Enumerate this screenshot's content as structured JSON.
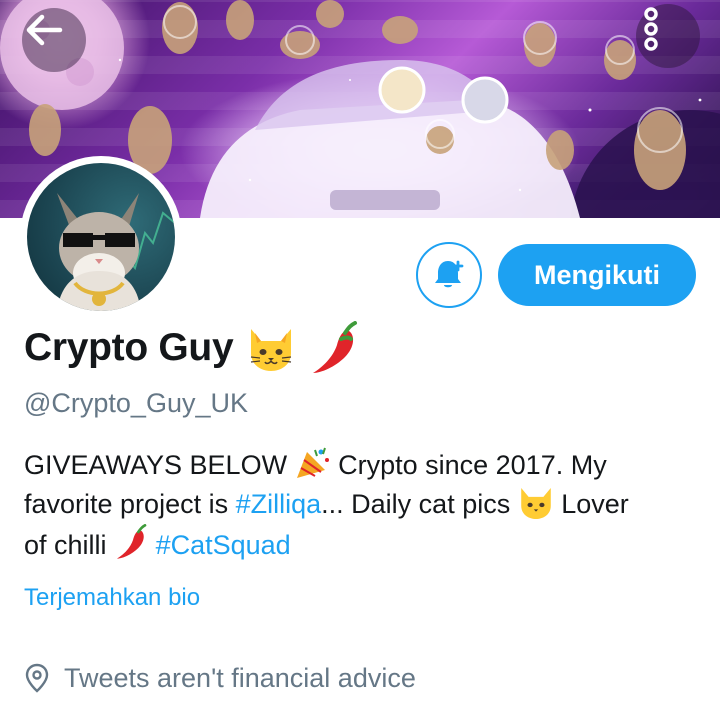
{
  "banner": {
    "back_icon": "arrow-left-icon",
    "menu_icon": "more-vertical-icon"
  },
  "profile": {
    "display_name": "Crypto Guy",
    "name_emojis": [
      "cat-face-icon",
      "chili-pepper-icon"
    ],
    "handle": "@Crypto_Guy_UK",
    "bio": {
      "line1_text": "GIVEAWAYS BELOW",
      "line1_after": "Crypto since 2017. My",
      "line2_before": "favorite project is",
      "hashtag_zilliqa": "#Zilliqa",
      "line2_after": "... Daily cat pics",
      "line2_end": "Lover",
      "line3_before": "of chilli",
      "hashtag_catsquad": "#CatSquad"
    },
    "translate_label": "Terjemahkan bio",
    "location": "Tweets aren't financial advice",
    "location_icon": "location-pin-icon"
  },
  "actions": {
    "notify_icon": "bell-plus-icon",
    "follow_label": "Mengikuti"
  },
  "colors": {
    "accent": "#1da1f2",
    "secondary_text": "#657786",
    "primary_text": "#14171a"
  }
}
